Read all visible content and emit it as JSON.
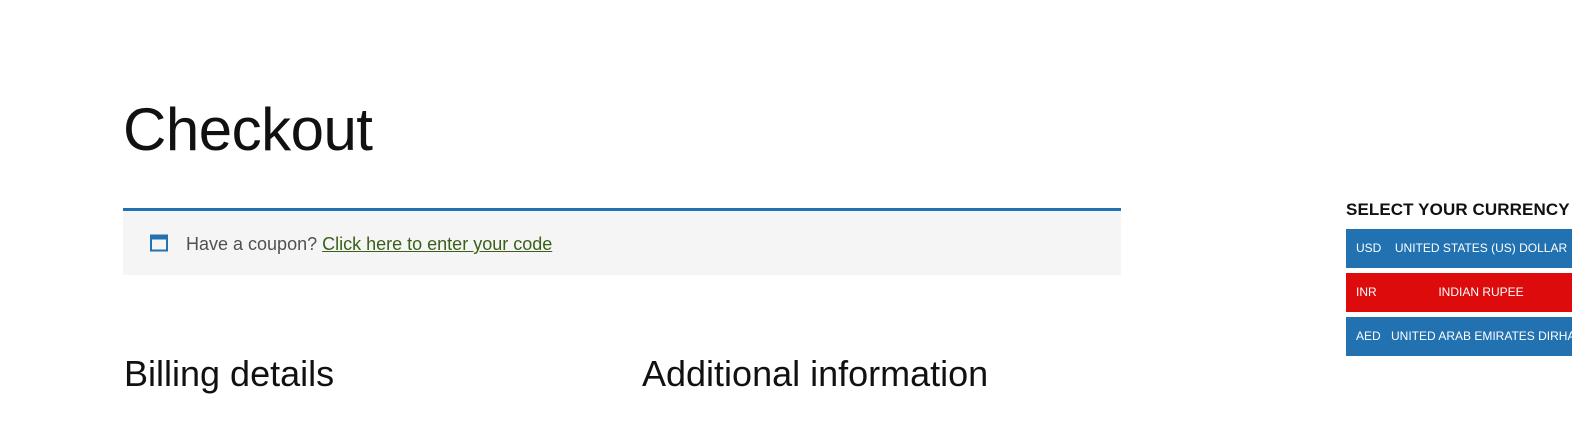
{
  "page": {
    "title": "Checkout"
  },
  "coupon_notice": {
    "prompt": "Have a coupon?",
    "link_text": "Click here to enter your code",
    "accent_color": "#2271b1",
    "icon": "window-icon"
  },
  "sections": {
    "billing_heading": "Billing details",
    "additional_heading": "Additional information"
  },
  "currency_selector": {
    "title": "SELECT YOUR CURRENCY",
    "options": [
      {
        "code": "USD",
        "name": "UNITED STATES (US) DOLLAR",
        "color": "#2271b1",
        "selected": false
      },
      {
        "code": "INR",
        "name": "INDIAN RUPEE",
        "color": "#dd0b0b",
        "selected": true
      },
      {
        "code": "AED",
        "name": "UNITED ARAB EMIRATES DIRHAM",
        "color": "#2271b1",
        "selected": false
      }
    ]
  }
}
